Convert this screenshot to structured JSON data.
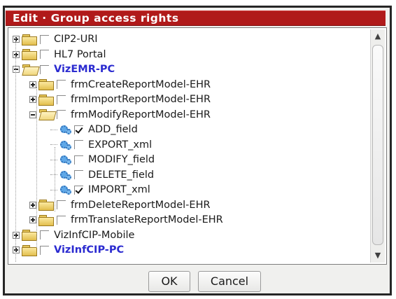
{
  "dialog": {
    "title": "Edit · Group access rights",
    "ok_label": "OK",
    "cancel_label": "Cancel"
  },
  "scrollbar": {
    "up_icon": "chevron-up-icon",
    "down_icon": "chevron-down-icon"
  },
  "tree": {
    "items": [
      {
        "label": "CIP2-URI",
        "level": 0,
        "type": "folder",
        "state": "collapsed",
        "checked": false,
        "highlight": false
      },
      {
        "label": "HL7 Portal",
        "level": 0,
        "type": "folder",
        "state": "collapsed",
        "checked": false,
        "highlight": false
      },
      {
        "label": "VizEMR-PC",
        "level": 0,
        "type": "folder",
        "state": "expanded",
        "checked": false,
        "highlight": true
      },
      {
        "label": "frmCreateReportModel-EHR",
        "level": 1,
        "type": "folder",
        "state": "collapsed",
        "checked": false,
        "highlight": false
      },
      {
        "label": "frmImportReportModel-EHR",
        "level": 1,
        "type": "folder",
        "state": "collapsed",
        "checked": false,
        "highlight": false
      },
      {
        "label": "frmModifyReportModel-EHR",
        "level": 1,
        "type": "folder",
        "state": "expanded",
        "checked": false,
        "highlight": false
      },
      {
        "label": "ADD_field",
        "level": 2,
        "type": "action",
        "checked": true,
        "highlight": false
      },
      {
        "label": "EXPORT_xml",
        "level": 2,
        "type": "action",
        "checked": false,
        "highlight": false
      },
      {
        "label": "MODIFY_field",
        "level": 2,
        "type": "action",
        "checked": false,
        "highlight": false
      },
      {
        "label": "DELETE_field",
        "level": 2,
        "type": "action",
        "checked": false,
        "highlight": false
      },
      {
        "label": "IMPORT_xml",
        "level": 2,
        "type": "action",
        "checked": true,
        "highlight": false
      },
      {
        "label": "frmDeleteReportModel-EHR",
        "level": 1,
        "type": "folder",
        "state": "collapsed",
        "checked": false,
        "highlight": false
      },
      {
        "label": "frmTranslateReportModel-EHR",
        "level": 1,
        "type": "folder",
        "state": "collapsed",
        "checked": false,
        "highlight": false
      },
      {
        "label": "VizInfCIP-Mobile",
        "level": 0,
        "type": "folder",
        "state": "collapsed",
        "checked": false,
        "highlight": false
      },
      {
        "label": "VizInfCIP-PC",
        "level": 0,
        "type": "folder",
        "state": "collapsed",
        "checked": false,
        "highlight": true
      }
    ]
  },
  "colors": {
    "title_bar": "#b01a1a",
    "highlight_text": "#2b2bd0"
  }
}
